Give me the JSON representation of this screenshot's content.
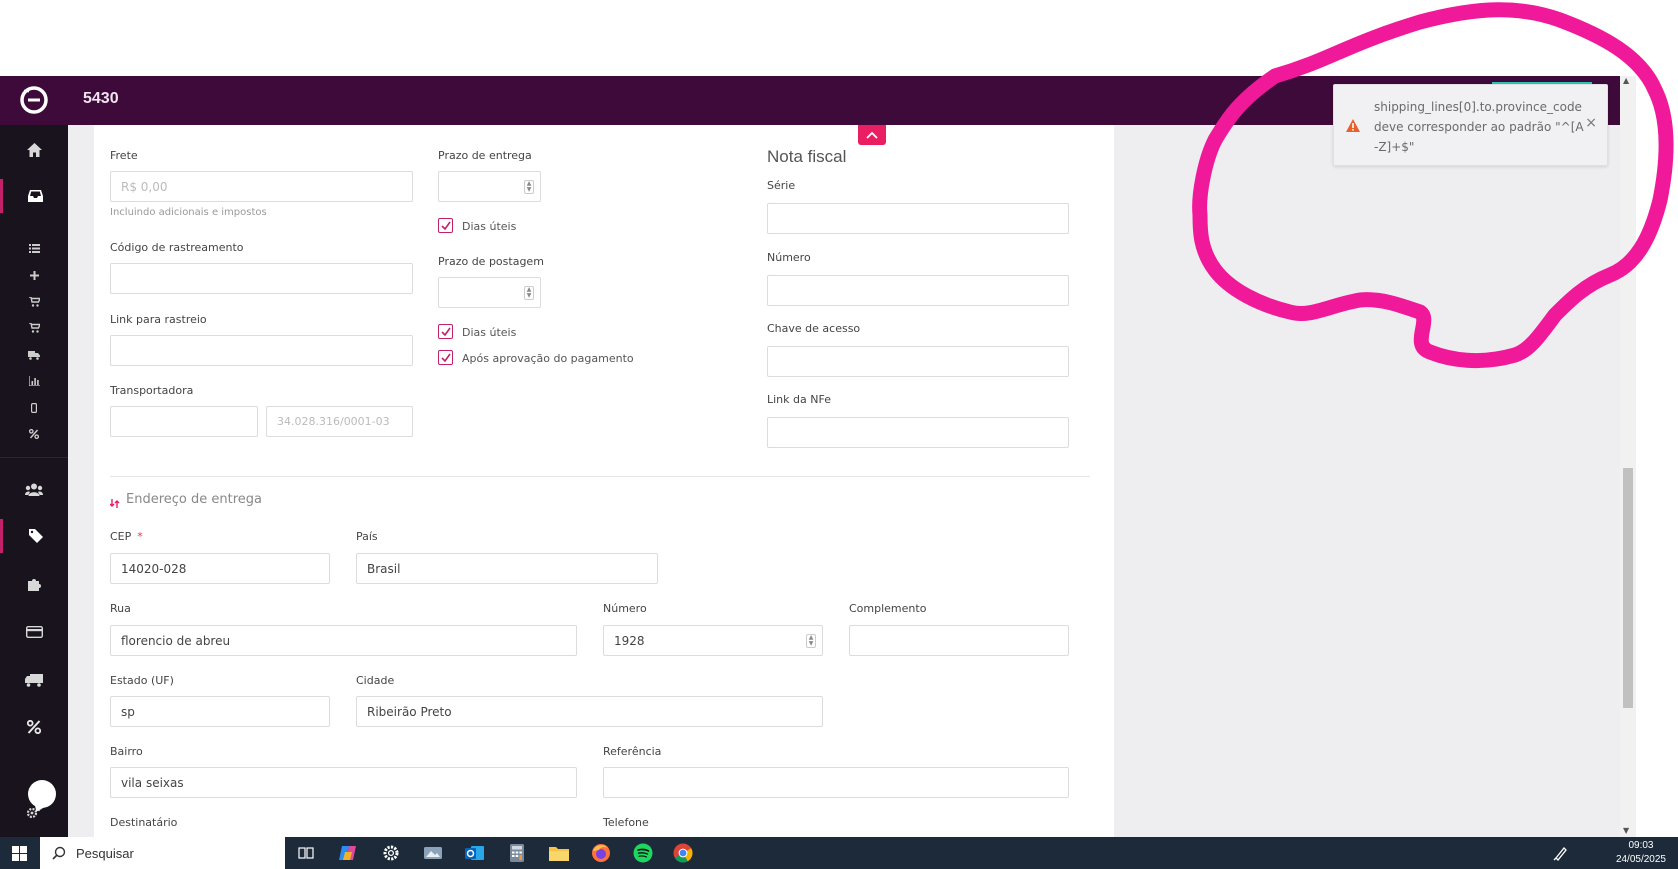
{
  "header": {
    "order_number": "5430"
  },
  "form": {
    "frete": {
      "label": "Frete",
      "placeholder": "R$ 0,00",
      "help": "Incluindo adicionais e impostos"
    },
    "prazo_entrega": {
      "label": "Prazo de entrega",
      "dias_uteis_label": "Dias úteis"
    },
    "codigo_rastreamento": {
      "label": "Código de rastreamento"
    },
    "prazo_postagem": {
      "label": "Prazo de postagem",
      "dias_uteis_label": "Dias úteis",
      "apos_aprovacao_label": "Após aprovação do pagamento"
    },
    "link_rastreio": {
      "label": "Link para rastreio"
    },
    "transportadora": {
      "label": "Transportadora",
      "cnpj_placeholder": "34.028.316/0001-03"
    },
    "nota_fiscal": {
      "title": "Nota fiscal",
      "serie_label": "Série",
      "numero_label": "Número",
      "chave_label": "Chave de acesso",
      "link_label": "Link da NFe"
    }
  },
  "address": {
    "section_title": "Endereço de entrega",
    "cep": {
      "label": "CEP",
      "required_mark": "*",
      "value": "14020-028"
    },
    "pais": {
      "label": "País",
      "value": "Brasil"
    },
    "rua": {
      "label": "Rua",
      "value": "florencio de abreu"
    },
    "numero": {
      "label": "Número",
      "value": "1928"
    },
    "complemento": {
      "label": "Complemento",
      "value": ""
    },
    "estado": {
      "label": "Estado (UF)",
      "value": "sp"
    },
    "cidade": {
      "label": "Cidade",
      "value": "Ribeirão Preto"
    },
    "bairro": {
      "label": "Bairro",
      "value": "vila seixas"
    },
    "referencia": {
      "label": "Referência",
      "value": ""
    },
    "destinatario": {
      "label": "Destinatário"
    },
    "telefone": {
      "label": "Telefone"
    }
  },
  "toast": {
    "message": "shipping_lines[0].to.province_code deve corresponder ao padrão \"^[A-Z]+$\"",
    "close_label": "×",
    "icon": "warning-icon"
  },
  "taskbar": {
    "search_label": "Pesquisar",
    "time": "09:03",
    "date": "24/05/2025"
  },
  "colors": {
    "topbar": "#3d0a3a",
    "accent": "#e91e63",
    "sidebar": "#18131c",
    "annotation": "#f0199a",
    "warning": "#e8612c"
  }
}
